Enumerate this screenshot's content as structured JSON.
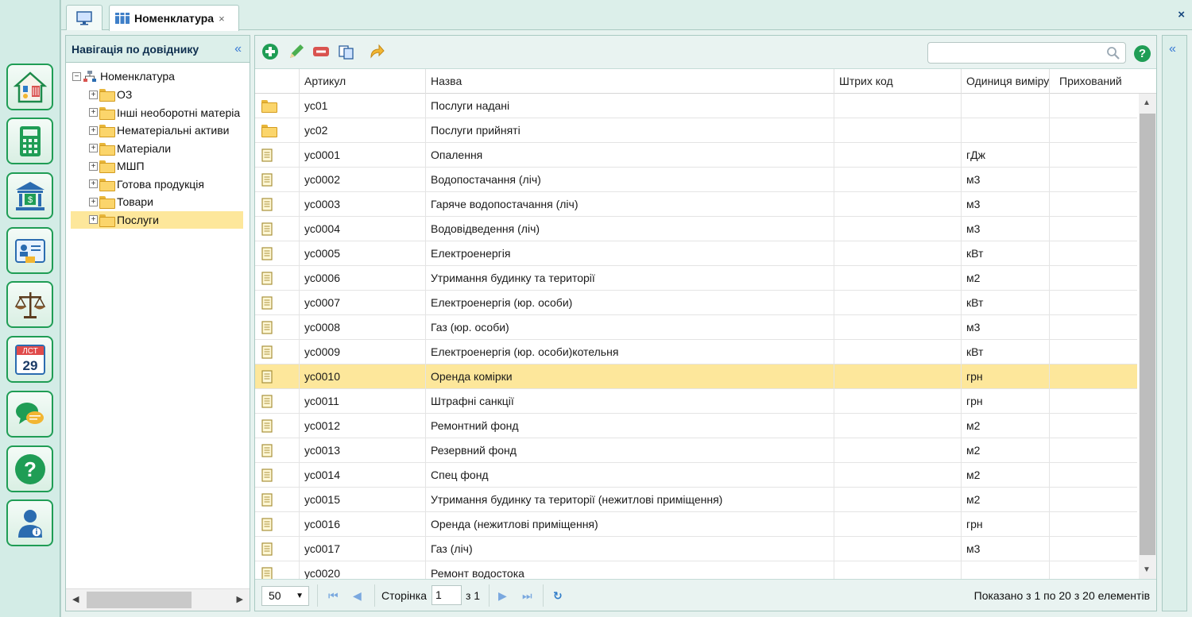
{
  "tabs": [
    {
      "label": ""
    },
    {
      "label": "Номенклатура",
      "close": "×"
    }
  ],
  "frame_close": "×",
  "sidebar_apps": [
    {
      "icon": "utilities-house-icon"
    },
    {
      "icon": "calculator-icon"
    },
    {
      "icon": "bank-icon"
    },
    {
      "icon": "id-card-icon"
    },
    {
      "icon": "scales-icon"
    },
    {
      "icon": "calendar-icon",
      "top_text": "ЛСТ",
      "day": "29"
    },
    {
      "icon": "chat-icon"
    },
    {
      "icon": "help-icon"
    },
    {
      "icon": "user-info-icon"
    }
  ],
  "nav": {
    "title": "Навігація по довіднику",
    "collapse": "«",
    "root": "Номенклатура",
    "items": [
      {
        "label": "ОЗ",
        "expander": "+"
      },
      {
        "label": "Інші необоротні матеріа",
        "expander": "+"
      },
      {
        "label": "Нематеріальні активи",
        "expander": "+"
      },
      {
        "label": "Матеріали",
        "expander": "+"
      },
      {
        "label": "МШП",
        "expander": "+"
      },
      {
        "label": "Готова продукція",
        "expander": "+"
      },
      {
        "label": "Товари",
        "expander": "+"
      },
      {
        "label": "Послуги",
        "expander": "+",
        "selected": true
      }
    ],
    "root_expander": "−"
  },
  "search": {
    "placeholder": ""
  },
  "help_label": "?",
  "columns": [
    "Артикул",
    "Назва",
    "Штрих код",
    "Одиниця виміру",
    "Прихований"
  ],
  "rows": [
    {
      "type": "folder",
      "code": "ус01",
      "name": "Послуги надані",
      "barcode": "",
      "unit": "",
      "hidden": ""
    },
    {
      "type": "folder",
      "code": "ус02",
      "name": "Послуги прийняті",
      "barcode": "",
      "unit": "",
      "hidden": ""
    },
    {
      "type": "doc",
      "code": "ус0001",
      "name": "Опалення",
      "barcode": "",
      "unit": "гДж",
      "hidden": ""
    },
    {
      "type": "doc",
      "code": "ус0002",
      "name": "Водопостачання (ліч)",
      "barcode": "",
      "unit": "м3",
      "hidden": ""
    },
    {
      "type": "doc",
      "code": "ус0003",
      "name": "Гаряче водопостачання (ліч)",
      "barcode": "",
      "unit": "м3",
      "hidden": ""
    },
    {
      "type": "doc",
      "code": "ус0004",
      "name": "Водовідведення (ліч)",
      "barcode": "",
      "unit": "м3",
      "hidden": ""
    },
    {
      "type": "doc",
      "code": "ус0005",
      "name": "Електроенергія",
      "barcode": "",
      "unit": "кВт",
      "hidden": ""
    },
    {
      "type": "doc",
      "code": "ус0006",
      "name": "Утримання будинку та території",
      "barcode": "",
      "unit": "м2",
      "hidden": ""
    },
    {
      "type": "doc",
      "code": "ус0007",
      "name": "Електроенергія (юр. особи)",
      "barcode": "",
      "unit": "кВт",
      "hidden": ""
    },
    {
      "type": "doc",
      "code": "ус0008",
      "name": "Газ (юр. особи)",
      "barcode": "",
      "unit": "м3",
      "hidden": ""
    },
    {
      "type": "doc",
      "code": "ус0009",
      "name": "Електроенергія (юр. особи)котельня",
      "barcode": "",
      "unit": "кВт",
      "hidden": ""
    },
    {
      "type": "doc",
      "code": "ус0010",
      "name": "Оренда комірки",
      "barcode": "",
      "unit": "грн",
      "hidden": "",
      "selected": true
    },
    {
      "type": "doc",
      "code": "ус0011",
      "name": "Штрафні санкції",
      "barcode": "",
      "unit": "грн",
      "hidden": ""
    },
    {
      "type": "doc",
      "code": "ус0012",
      "name": "Ремонтний фонд",
      "barcode": "",
      "unit": "м2",
      "hidden": ""
    },
    {
      "type": "doc",
      "code": "ус0013",
      "name": "Резервний фонд",
      "barcode": "",
      "unit": "м2",
      "hidden": ""
    },
    {
      "type": "doc",
      "code": "ус0014",
      "name": "Спец фонд",
      "barcode": "",
      "unit": "м2",
      "hidden": ""
    },
    {
      "type": "doc",
      "code": "ус0015",
      "name": "Утримання будинку та території (нежитлові приміщення)",
      "barcode": "",
      "unit": "м2",
      "hidden": ""
    },
    {
      "type": "doc",
      "code": "ус0016",
      "name": "Оренда (нежитлові приміщення)",
      "barcode": "",
      "unit": "грн",
      "hidden": ""
    },
    {
      "type": "doc",
      "code": "ус0017",
      "name": "Газ (ліч)",
      "barcode": "",
      "unit": "м3",
      "hidden": ""
    },
    {
      "type": "doc",
      "code": "ус0020",
      "name": "Ремонт водостока",
      "barcode": "",
      "unit": "",
      "hidden": ""
    }
  ],
  "pager": {
    "page_size": "50",
    "page_label": "Сторінка",
    "page": "1",
    "of_label": "з 1",
    "info": "Показано з 1 по 20 з 20 елементів"
  },
  "right_panel": {
    "collapse": "«"
  },
  "colors": {
    "accent_green": "#1f9d55",
    "selection": "#fde79b",
    "pager_blue": "#7aa8df"
  }
}
